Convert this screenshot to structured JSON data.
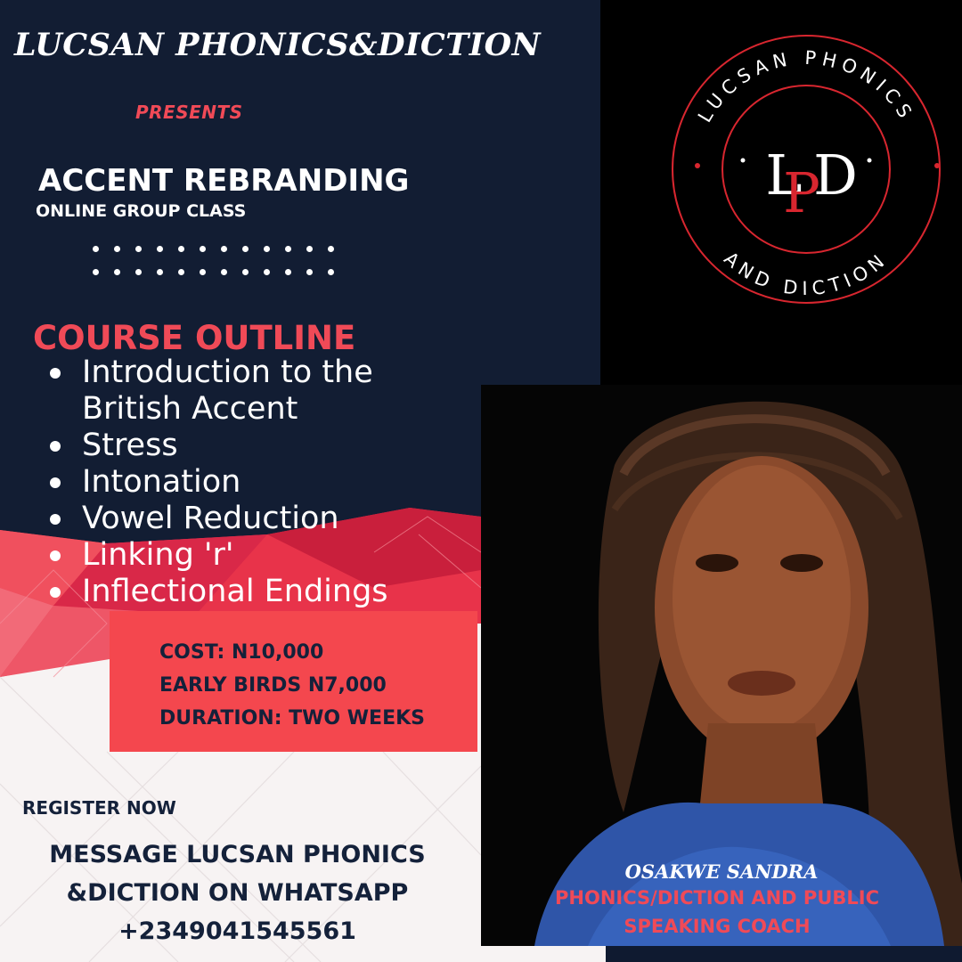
{
  "header": {
    "brand": "LUCSAN PHONICS&DICTION",
    "presents": "PRESENTS",
    "course_name": "ACCENT REBRANDING",
    "course_subtitle": "ONLINE GROUP CLASS"
  },
  "outline": {
    "heading": "COURSE OUTLINE",
    "items": [
      "Introduction to the British Accent",
      "Stress",
      "Intonation",
      "Vowel Reduction",
      "Linking 'r'",
      "Inflectional Endings"
    ]
  },
  "pricing": {
    "cost": "COST: N10,000",
    "early_birds": "EARLY BIRDS N7,000",
    "duration": "DURATION: TWO WEEKS"
  },
  "contact": {
    "register": "REGISTER NOW",
    "message_line1": "MESSAGE LUCSAN PHONICS",
    "message_line2": "&DICTION ON WHATSAPP",
    "phone": "+2349041545561"
  },
  "logo": {
    "ring_top": "LUCSAN PHONICS",
    "ring_bottom": "AND DICTION",
    "monogram": "LPD"
  },
  "coach": {
    "name": "OSAKWE SANDRA",
    "title": "PHONICS/DICTION AND PUBLIC SPEAKING COACH"
  },
  "colors": {
    "navy": "#121d33",
    "accent_red": "#f04a57",
    "box_red": "#f4474e",
    "text_dark": "#14213a"
  }
}
